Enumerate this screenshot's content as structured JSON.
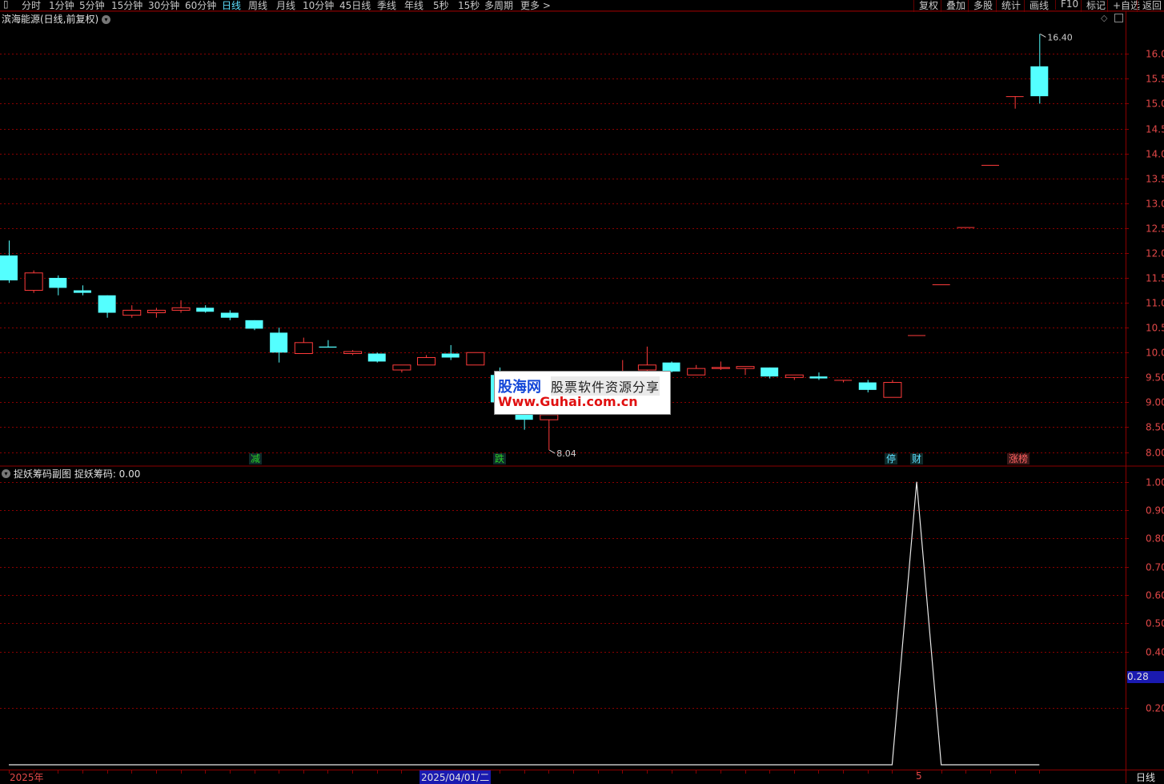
{
  "toolbar": {
    "items": [
      "分时",
      "1分钟",
      "5分钟",
      "15分钟",
      "30分钟",
      "60分钟",
      "日线",
      "周线",
      "月线",
      "10分钟",
      "45日线",
      "季线",
      "年线",
      "5秒",
      "15秒",
      "多周期",
      "更多 >"
    ],
    "active": "日线",
    "right_items": [
      "复权",
      "叠加",
      "多股",
      "统计",
      "画线",
      "F10",
      "标记",
      "+自选",
      "返回"
    ]
  },
  "main": {
    "title": "滨海能源(日线,前复权)",
    "y_ticks": [
      "16.00",
      "15.50",
      "15.00",
      "14.50",
      "14.00",
      "13.50",
      "13.00",
      "12.50",
      "12.00",
      "11.50",
      "11.00",
      "10.50",
      "10.00",
      "9.50",
      "9.00",
      "8.50",
      "8.00"
    ],
    "high_label": "16.40",
    "low_label": "8.04",
    "markers": [
      {
        "text": "减",
        "color": "#29d029"
      },
      {
        "text": "跌",
        "color": "#29d029"
      },
      {
        "text": "停",
        "color": "#5ee0ff"
      },
      {
        "text": "财",
        "color": "#5ee0ff"
      },
      {
        "text": "涨榜",
        "color": "#ff6060"
      }
    ]
  },
  "sub": {
    "title": "捉妖筹码副图  捉妖筹码: 0.00",
    "y_ticks": [
      "1.00",
      "0.90",
      "0.80",
      "0.70",
      "0.60",
      "0.50",
      "0.40",
      "0.28",
      "0.20"
    ],
    "current_value": "0.28"
  },
  "watermark": {
    "brand": "股海网",
    "slogan": "股票软件资源分享",
    "url": "Www.Guhai.com.cn"
  },
  "bottom": {
    "year": "2025年",
    "date": "2025/04/01/二",
    "cursor": "5",
    "period": "日线"
  },
  "colors": {
    "up": "#ff3b3b",
    "down": "#54ffff",
    "grid": "#8b0000",
    "axis_text": "#e24848"
  },
  "chart_data": {
    "type": "candlestick",
    "ylim": [
      7.8,
      16.6
    ],
    "candles": [
      {
        "o": 11.95,
        "h": 12.25,
        "l": 11.4,
        "c": 11.45
      },
      {
        "o": 11.25,
        "h": 11.65,
        "l": 11.2,
        "c": 11.6
      },
      {
        "o": 11.5,
        "h": 11.55,
        "l": 11.15,
        "c": 11.3
      },
      {
        "o": 11.25,
        "h": 11.35,
        "l": 11.15,
        "c": 11.2
      },
      {
        "o": 11.15,
        "h": 11.15,
        "l": 10.7,
        "c": 10.8
      },
      {
        "o": 10.75,
        "h": 10.95,
        "l": 10.7,
        "c": 10.85
      },
      {
        "o": 10.8,
        "h": 10.9,
        "l": 10.7,
        "c": 10.85
      },
      {
        "o": 10.85,
        "h": 11.05,
        "l": 10.8,
        "c": 10.9
      },
      {
        "o": 10.9,
        "h": 10.95,
        "l": 10.8,
        "c": 10.82
      },
      {
        "o": 10.8,
        "h": 10.85,
        "l": 10.65,
        "c": 10.7
      },
      {
        "o": 10.65,
        "h": 10.65,
        "l": 10.45,
        "c": 10.48
      },
      {
        "o": 10.4,
        "h": 10.5,
        "l": 9.8,
        "c": 10.0
      },
      {
        "o": 9.98,
        "h": 10.3,
        "l": 9.98,
        "c": 10.2
      },
      {
        "o": 10.12,
        "h": 10.25,
        "l": 10.1,
        "c": 10.1
      },
      {
        "o": 9.98,
        "h": 10.05,
        "l": 9.95,
        "c": 10.02
      },
      {
        "o": 9.98,
        "h": 10.0,
        "l": 9.8,
        "c": 9.82
      },
      {
        "o": 9.65,
        "h": 9.75,
        "l": 9.6,
        "c": 9.75
      },
      {
        "o": 9.75,
        "h": 9.95,
        "l": 9.75,
        "c": 9.9
      },
      {
        "o": 9.98,
        "h": 10.15,
        "l": 9.85,
        "c": 9.9
      },
      {
        "o": 9.75,
        "h": 10.0,
        "l": 9.75,
        "c": 10.0
      },
      {
        "o": 9.55,
        "h": 9.7,
        "l": 8.9,
        "c": 9.0
      },
      {
        "o": 8.9,
        "h": 9.1,
        "l": 8.45,
        "c": 8.65
      },
      {
        "o": 8.65,
        "h": 8.9,
        "l": 8.04,
        "c": 8.75
      },
      {
        "o": 8.8,
        "h": 9.2,
        "l": 8.75,
        "c": 9.1
      },
      {
        "o": 9.2,
        "h": 9.4,
        "l": 9.1,
        "c": 9.3
      },
      {
        "o": 9.45,
        "h": 9.85,
        "l": 9.4,
        "c": 9.6
      },
      {
        "o": 9.65,
        "h": 10.12,
        "l": 9.55,
        "c": 9.75
      },
      {
        "o": 9.8,
        "h": 9.82,
        "l": 9.6,
        "c": 9.62
      },
      {
        "o": 9.55,
        "h": 9.75,
        "l": 9.55,
        "c": 9.68
      },
      {
        "o": 9.68,
        "h": 9.82,
        "l": 9.65,
        "c": 9.7
      },
      {
        "o": 9.68,
        "h": 9.7,
        "l": 9.55,
        "c": 9.72
      },
      {
        "o": 9.7,
        "h": 9.7,
        "l": 9.48,
        "c": 9.52
      },
      {
        "o": 9.5,
        "h": 9.55,
        "l": 9.45,
        "c": 9.55
      },
      {
        "o": 9.52,
        "h": 9.6,
        "l": 9.45,
        "c": 9.48
      },
      {
        "o": 9.45,
        "h": 9.45,
        "l": 9.4,
        "c": 9.45
      },
      {
        "o": 9.4,
        "h": 9.45,
        "l": 9.2,
        "c": 9.25
      },
      {
        "o": 9.1,
        "h": 9.45,
        "l": 9.1,
        "c": 9.4
      },
      {
        "o": 10.35,
        "h": 10.35,
        "l": 10.35,
        "c": 10.35
      },
      {
        "o": 11.37,
        "h": 11.37,
        "l": 11.37,
        "c": 11.37
      },
      {
        "o": 12.52,
        "h": 12.52,
        "l": 12.52,
        "c": 12.52
      },
      {
        "o": 13.77,
        "h": 13.77,
        "l": 13.77,
        "c": 13.77
      },
      {
        "o": 15.15,
        "h": 15.15,
        "l": 14.9,
        "c": 15.15
      },
      {
        "o": 15.75,
        "h": 16.4,
        "l": 15.0,
        "c": 15.15
      }
    ],
    "indicator": {
      "name": "捉妖筹码",
      "ylim": [
        0,
        1.05
      ],
      "values": [
        0,
        0,
        0,
        0,
        0,
        0,
        0,
        0,
        0,
        0,
        0,
        0,
        0,
        0,
        0,
        0,
        0,
        0,
        0,
        0,
        0,
        0,
        0,
        0,
        0,
        0,
        0,
        0,
        0,
        0,
        0,
        0,
        0,
        0,
        0,
        0,
        0,
        1,
        0,
        0,
        0,
        0,
        0
      ]
    }
  }
}
